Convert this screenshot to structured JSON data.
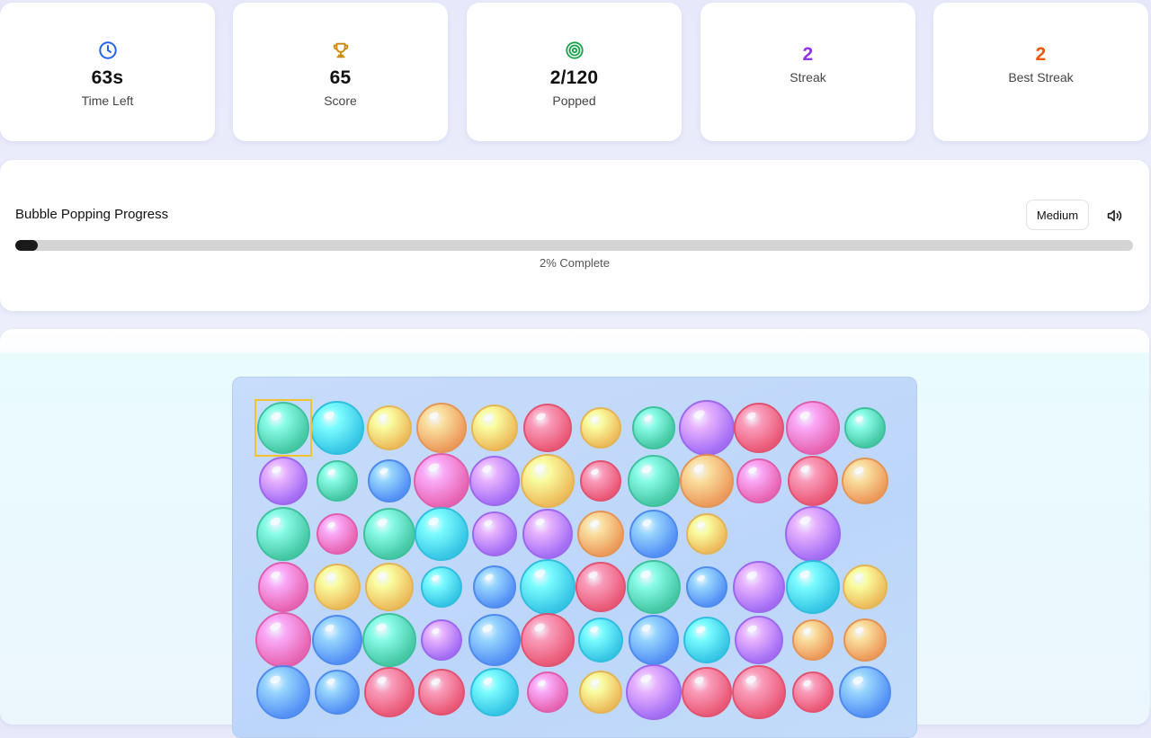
{
  "stats": [
    {
      "id": "time",
      "icon": "clock-icon",
      "value": "63s",
      "label": "Time Left",
      "icon_color": "#2563eb",
      "value_color": "#111111"
    },
    {
      "id": "score",
      "icon": "trophy-icon",
      "value": "65",
      "label": "Score",
      "icon_color": "#ca8a04",
      "value_color": "#111111"
    },
    {
      "id": "popped",
      "icon": "target-icon",
      "value": "2/120",
      "label": "Popped",
      "icon_color": "#16a34a",
      "value_color": "#111111"
    },
    {
      "id": "streak",
      "icon": "",
      "value": "2",
      "label": "Streak",
      "icon_color": "",
      "value_color": "#9333ea"
    },
    {
      "id": "best",
      "icon": "",
      "value": "2",
      "label": "Best Streak",
      "icon_color": "",
      "value_color": "#ea580c"
    }
  ],
  "progress": {
    "title": "Bubble Popping Progress",
    "difficulty": "Medium",
    "percent": 2,
    "text": "2% Complete",
    "sound_icon": "speaker-icon"
  },
  "board": {
    "selected": {
      "row": 0,
      "col": 0
    },
    "colors": {
      "teal": "#3fcaa0",
      "cyan": "#2fc7e6",
      "orange": "#f29a52",
      "gold": "#f2bd52",
      "red": "#ef5270",
      "pink": "#ec5fb0",
      "purple": "#a569f6",
      "blue": "#4f8ff6"
    },
    "rows": [
      [
        "teal",
        "cyan",
        "gold",
        "orange",
        "gold",
        "red",
        "gold",
        "teal",
        "purple",
        "red",
        "pink",
        "teal"
      ],
      [
        "purple",
        "teal",
        "blue",
        "pink",
        "purple",
        "gold",
        "red",
        "teal",
        "orange",
        "pink",
        "red",
        "orange"
      ],
      [
        "teal",
        "pink",
        "teal",
        "cyan",
        "purple",
        "purple",
        "orange",
        "blue",
        "gold",
        "",
        "purple",
        ""
      ],
      [
        "pink",
        "gold",
        "gold",
        "cyan",
        "blue",
        "cyan",
        "red",
        "teal",
        "blue",
        "purple",
        "cyan",
        "gold"
      ],
      [
        "pink",
        "blue",
        "teal",
        "purple",
        "blue",
        "red",
        "cyan",
        "blue",
        "cyan",
        "purple",
        "orange",
        "orange"
      ],
      [
        "blue",
        "blue",
        "red",
        "red",
        "cyan",
        "pink",
        "gold",
        "purple",
        "red",
        "red",
        "red",
        "blue"
      ]
    ]
  }
}
